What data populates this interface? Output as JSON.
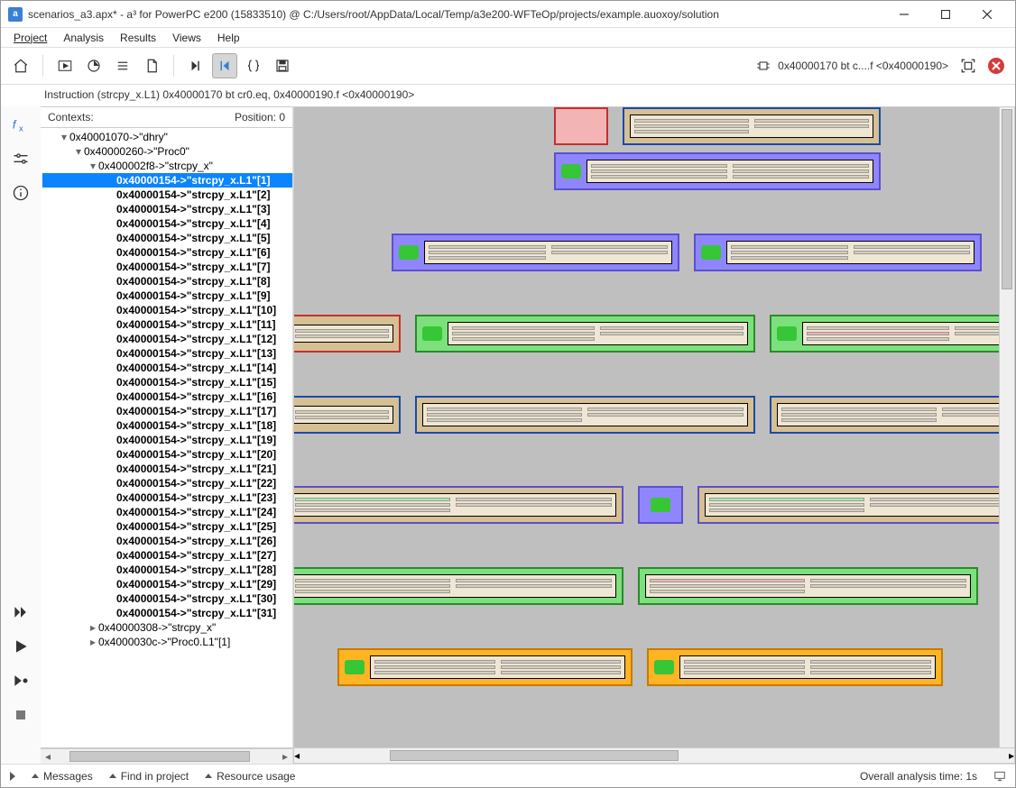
{
  "window": {
    "title": "scenarios_a3.apx* - a³ for PowerPC e200 (15833510) @ C:/Users/root/AppData/Local/Temp/a3e200-WFTeOp/projects/example.auoxoy/solution"
  },
  "menu": {
    "project": "Project",
    "analysis": "Analysis",
    "results": "Results",
    "views": "Views",
    "help": "Help"
  },
  "toolbar": {
    "right_label": "0x40000170 bt c....f <0x40000190>"
  },
  "instruction_line": "Instruction (strcpy_x.L1) 0x40000170 bt cr0.eq, 0x40000190.f <0x40000190>",
  "contexts": {
    "header": "Contexts:",
    "position_label": "Position: 0",
    "root": "0x40001070->\"dhry\"",
    "proc0": "0x40000260->\"Proc0\"",
    "strcpy_x": "0x400002f8->\"strcpy_x\"",
    "items": [
      "0x40000154->\"strcpy_x.L1\"[1]",
      "0x40000154->\"strcpy_x.L1\"[2]",
      "0x40000154->\"strcpy_x.L1\"[3]",
      "0x40000154->\"strcpy_x.L1\"[4]",
      "0x40000154->\"strcpy_x.L1\"[5]",
      "0x40000154->\"strcpy_x.L1\"[6]",
      "0x40000154->\"strcpy_x.L1\"[7]",
      "0x40000154->\"strcpy_x.L1\"[8]",
      "0x40000154->\"strcpy_x.L1\"[9]",
      "0x40000154->\"strcpy_x.L1\"[10]",
      "0x40000154->\"strcpy_x.L1\"[11]",
      "0x40000154->\"strcpy_x.L1\"[12]",
      "0x40000154->\"strcpy_x.L1\"[13]",
      "0x40000154->\"strcpy_x.L1\"[14]",
      "0x40000154->\"strcpy_x.L1\"[15]",
      "0x40000154->\"strcpy_x.L1\"[16]",
      "0x40000154->\"strcpy_x.L1\"[17]",
      "0x40000154->\"strcpy_x.L1\"[18]",
      "0x40000154->\"strcpy_x.L1\"[19]",
      "0x40000154->\"strcpy_x.L1\"[20]",
      "0x40000154->\"strcpy_x.L1\"[21]",
      "0x40000154->\"strcpy_x.L1\"[22]",
      "0x40000154->\"strcpy_x.L1\"[23]",
      "0x40000154->\"strcpy_x.L1\"[24]",
      "0x40000154->\"strcpy_x.L1\"[25]",
      "0x40000154->\"strcpy_x.L1\"[26]",
      "0x40000154->\"strcpy_x.L1\"[27]",
      "0x40000154->\"strcpy_x.L1\"[28]",
      "0x40000154->\"strcpy_x.L1\"[29]",
      "0x40000154->\"strcpy_x.L1\"[30]",
      "0x40000154->\"strcpy_x.L1\"[31]"
    ],
    "branch2": "0x40000308->\"strcpy_x\"",
    "branch3": "0x4000030c->\"Proc0.L1\"[1]"
  },
  "status": {
    "messages": "Messages",
    "find": "Find in project",
    "resource": "Resource usage",
    "analysis_time": "Overall analysis time: 1s"
  }
}
